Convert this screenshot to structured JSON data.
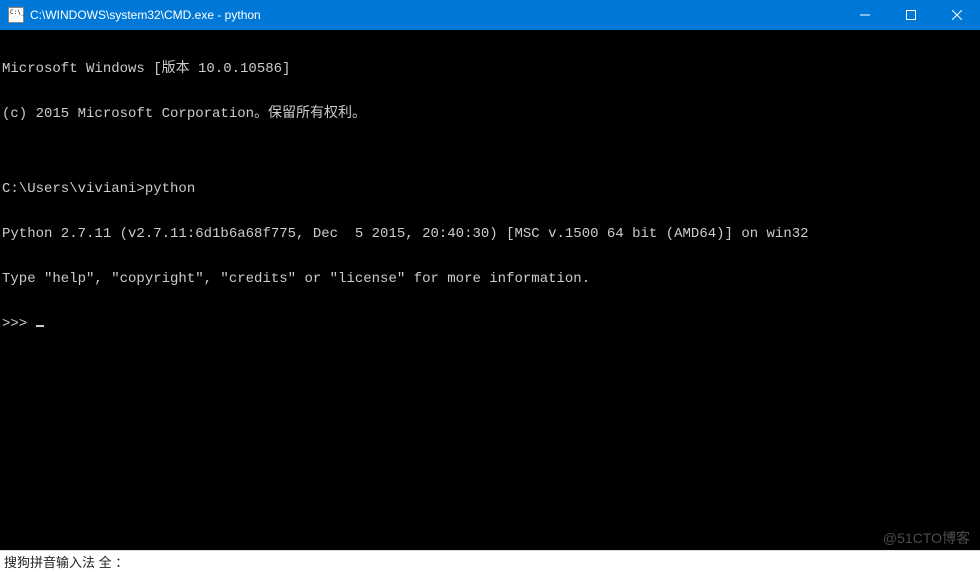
{
  "window": {
    "title": "C:\\WINDOWS\\system32\\CMD.exe - python"
  },
  "terminal": {
    "lines": [
      "Microsoft Windows [版本 10.0.10586]",
      "(c) 2015 Microsoft Corporation。保留所有权利。",
      "",
      "C:\\Users\\viviani>python",
      "Python 2.7.11 (v2.7.11:6d1b6a68f775, Dec  5 2015, 20:40:30) [MSC v.1500 64 bit (AMD64)] on win32",
      "Type \"help\", \"copyright\", \"credits\" or \"license\" for more information.",
      ">>> "
    ]
  },
  "ime": {
    "status": "搜狗拼音输入法 全 ："
  },
  "watermark": "@51CTO博客"
}
